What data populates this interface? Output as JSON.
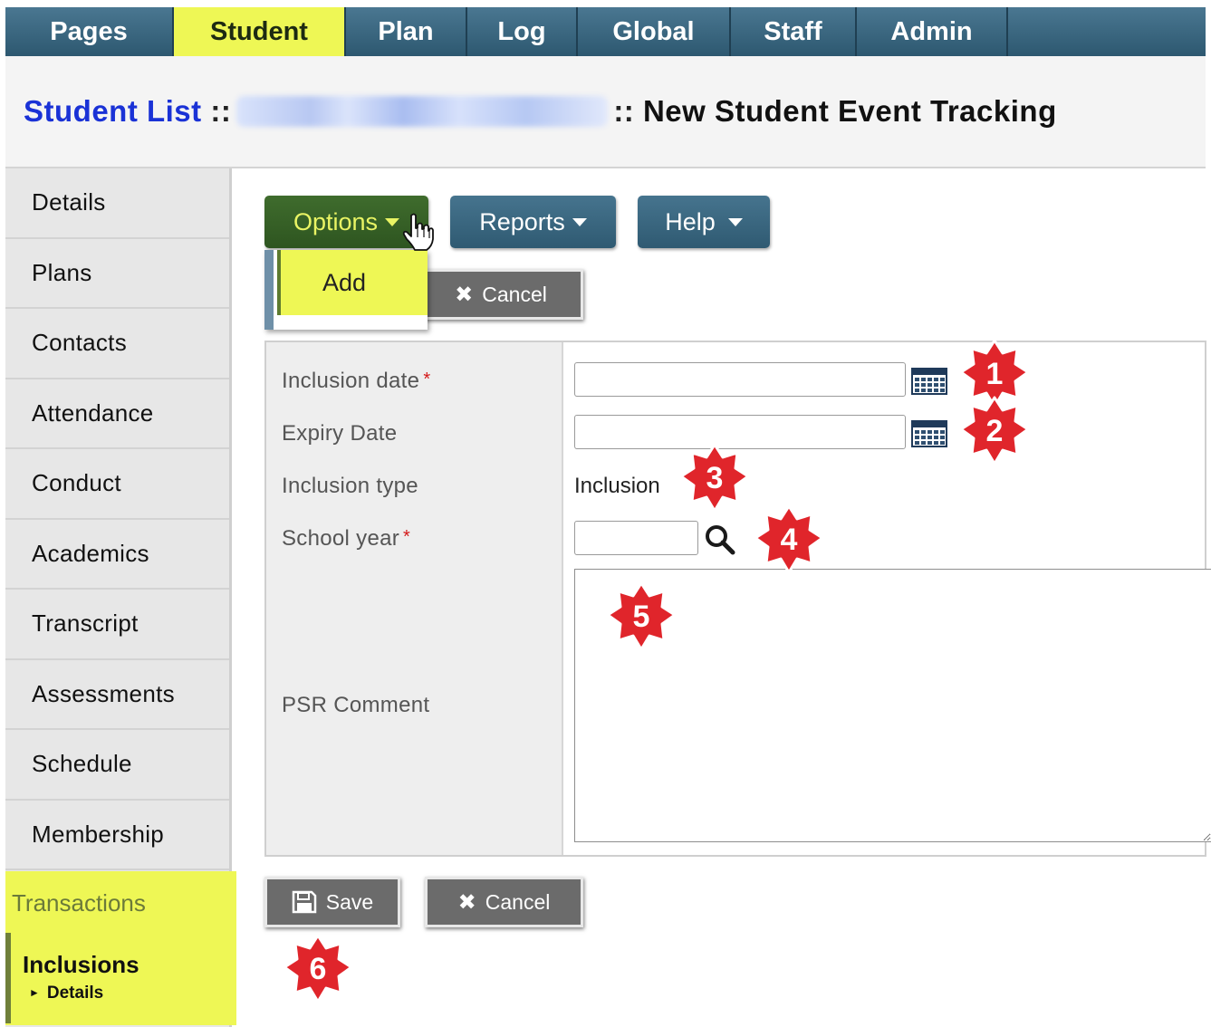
{
  "topnav": {
    "tabs": [
      {
        "label": "Pages",
        "active": false
      },
      {
        "label": "Student",
        "active": true
      },
      {
        "label": "Plan",
        "active": false
      },
      {
        "label": "Log",
        "active": false
      },
      {
        "label": "Global",
        "active": false
      },
      {
        "label": "Staff",
        "active": false
      },
      {
        "label": "Admin",
        "active": false
      }
    ]
  },
  "breadcrumb": {
    "link": "Student List",
    "separator": "::",
    "current": "New Student Event Tracking"
  },
  "sidebar": {
    "items": [
      "Details",
      "Plans",
      "Contacts",
      "Attendance",
      "Conduct",
      "Academics",
      "Transcript",
      "Assessments",
      "Schedule",
      "Membership"
    ],
    "section_label": "Transactions",
    "selected_item": "Inclusions",
    "selected_subitem": "Details"
  },
  "toolbar": {
    "options_label": "Options",
    "reports_label": "Reports",
    "help_label": "Help",
    "add_label": "Add",
    "cancel_label": "Cancel"
  },
  "form": {
    "inclusion_date": {
      "label": "Inclusion date",
      "required_mark": "*",
      "value": ""
    },
    "expiry_date": {
      "label": "Expiry Date",
      "value": ""
    },
    "inclusion_type": {
      "label": "Inclusion type",
      "value": "Inclusion"
    },
    "school_year": {
      "label": "School year",
      "required_mark": "*",
      "value": ""
    },
    "psr_comment": {
      "label": "PSR Comment",
      "value": ""
    }
  },
  "footer": {
    "save_label": "Save",
    "cancel_label": "Cancel"
  },
  "badges": [
    "1",
    "2",
    "3",
    "4",
    "5",
    "6"
  ],
  "colors": {
    "nav_bg": "#2d5870",
    "highlight": "#eef755",
    "options_bg": "#3f6c2d",
    "link_blue": "#1a32d6",
    "badge_red": "#e0252b",
    "required_red": "#d41818"
  },
  "icons": {
    "calendar": "calendar-icon",
    "search": "search-icon",
    "cancel": "close-icon",
    "save": "floppy-disk-icon",
    "cursor": "hand-cursor-icon"
  }
}
